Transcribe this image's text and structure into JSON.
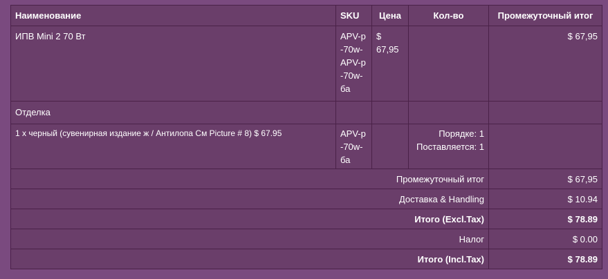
{
  "table": {
    "headers": {
      "name": "Наименование",
      "sku": "SKU",
      "price": "Цена",
      "qty": "Кол-во",
      "subtotal": "Промежуточный итог"
    },
    "item": {
      "name": "ИПВ Mini 2 70 Вт",
      "sku": "APV-p-70w-APV-p-70w-ба",
      "price": "$ 67,95",
      "subtotal": "$ 67,95"
    },
    "section_label": "Отделка",
    "option": {
      "name": "1 x черный (сувенирная издание ж / Антилопа См Picture # 8) $ 67.95",
      "sku": "APV-p-70w-ба",
      "qty_ordered": "Порядке: 1",
      "qty_shipped": "Поставляется: 1"
    }
  },
  "totals": [
    {
      "label": "Промежуточный итог",
      "value": "$ 67,95",
      "bold": false
    },
    {
      "label": "Доставка & Handling",
      "value": "$ 10.94",
      "bold": false
    },
    {
      "label": "Итого (Excl.Tax)",
      "value": "$ 78.89",
      "bold": true
    },
    {
      "label": "Налог",
      "value": "$ 0.00",
      "bold": false
    },
    {
      "label": "Итого (Incl.Tax)",
      "value": "$ 78.89",
      "bold": true
    }
  ]
}
